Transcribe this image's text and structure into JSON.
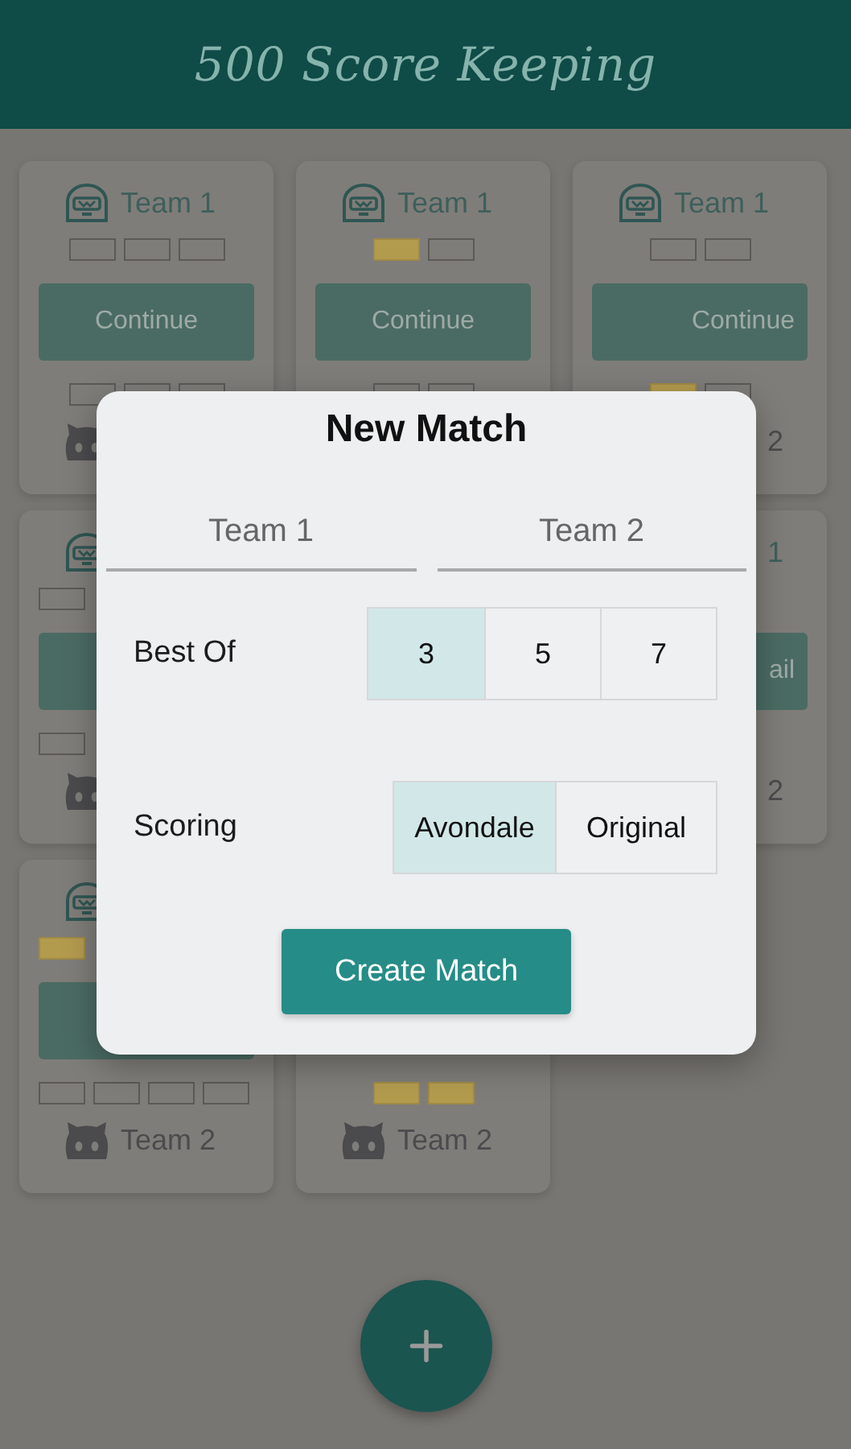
{
  "header": {
    "title": "500 Score Keeping"
  },
  "matches": [
    {
      "kind": "match",
      "team1": {
        "kind": "full",
        "name": "Team 1"
      },
      "team1_wins": [
        false,
        false,
        false
      ],
      "button": "Continue",
      "team2_wins": [
        false,
        false,
        false
      ],
      "team2": {
        "kind": "icon"
      }
    },
    {
      "kind": "match",
      "team1": {
        "kind": "full",
        "name": "Team 1"
      },
      "team1_wins": [
        true,
        false
      ],
      "button": "Continue",
      "team2_wins": [
        false,
        false
      ]
    },
    {
      "kind": "trailing",
      "team1": {
        "kind": "full",
        "name": "Team 1"
      },
      "team1_wins": [
        false,
        false
      ],
      "button": "Continue",
      "team2_wins": [
        true,
        false
      ],
      "team2": {
        "kind": "end",
        "name": "2"
      }
    },
    {
      "kind": "leading",
      "team1": {
        "kind": "icon"
      },
      "team1_wins": [
        false
      ],
      "button_hidden": true,
      "team2_wins": [
        false
      ],
      "team2": {
        "kind": "icon"
      }
    },
    {
      "kind": "covered"
    },
    {
      "kind": "trailing",
      "team1": {
        "kind": "end",
        "name": "1"
      },
      "button": "ail",
      "team2": {
        "kind": "end",
        "name": "2"
      }
    },
    {
      "kind": "leading",
      "team1": {
        "kind": "icon"
      },
      "team1_wins": [
        true
      ],
      "button_hidden": true,
      "team2_wins": [
        false,
        false,
        false,
        false
      ],
      "team2": {
        "kind": "full",
        "name": "Team 2"
      }
    },
    {
      "kind": "match",
      "team2_wins": [
        true,
        true
      ],
      "team2": {
        "kind": "full",
        "name": "Team 2"
      }
    }
  ],
  "fab": {
    "kind": "add"
  },
  "modal": {
    "title": "New Match",
    "fields": [
      {
        "placeholder": "Team 1"
      },
      {
        "placeholder": "Team 2"
      }
    ],
    "options": [
      {
        "label": "Best Of",
        "choices": [
          {
            "label": "3",
            "selected": true
          },
          {
            "label": "5",
            "selected": false
          },
          {
            "label": "7",
            "selected": false
          }
        ]
      },
      {
        "label": "Scoring",
        "choices": [
          {
            "label": "Avondale",
            "selected": true
          },
          {
            "label": "Original",
            "selected": false
          }
        ]
      }
    ],
    "button": "Create Match"
  }
}
